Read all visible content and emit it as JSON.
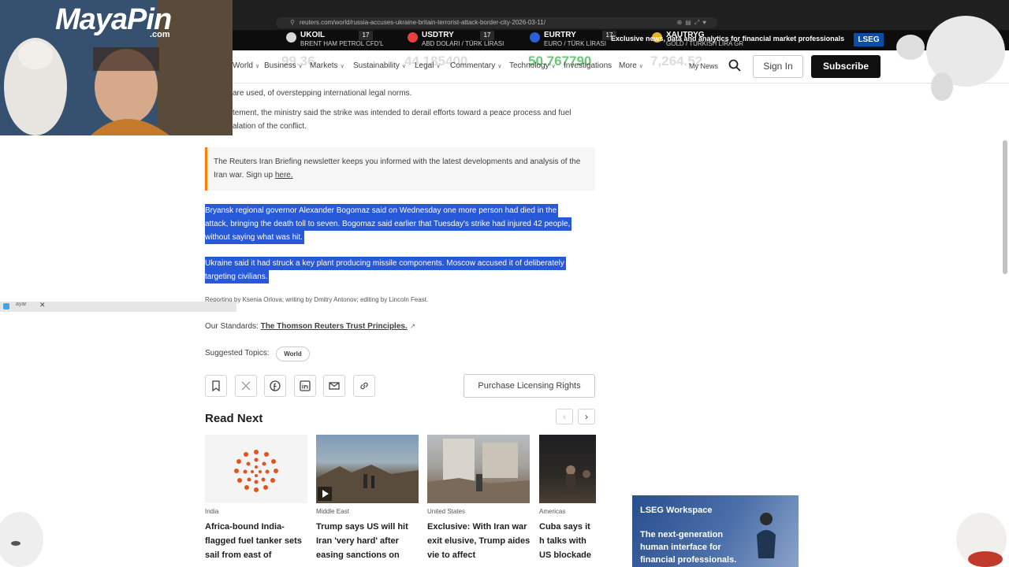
{
  "browser": {
    "url": "reuters.com/world/russia-accuses-ukraine-britain-terrorist-attack-border-city-2026-03-11/"
  },
  "ticker": [
    {
      "symbol": "UKOIL",
      "sub": "BRENT HAM PETROL CFD'L",
      "value": "99.36",
      "icon_color": "#d9d9d9"
    },
    {
      "symbol": "USDTRY",
      "sub": "ABD DOLARI / TÜRK LİRASI",
      "value": "44.185400",
      "icon_color": "#e8413c"
    },
    {
      "symbol": "EURTRY",
      "sub": "EURO / TÜRK LİRASI",
      "value": "50.767790",
      "icon_color": "#2b5fd9"
    },
    {
      "symbol": "XAUTRYG",
      "sub": "GOLD / TURKISH LIRA GR",
      "value": "7,264.52",
      "icon_color": "#e6b422"
    }
  ],
  "lseg_promo": {
    "text": "Exclusive news, data and analytics for financial market professionals",
    "badge": "LSEG"
  },
  "nav": {
    "items": [
      "World",
      "Business",
      "Markets",
      "Sustainability",
      "Legal",
      "Commentary",
      "Technology",
      "Investigations",
      "More"
    ],
    "my_news": "My News",
    "sign_in": "Sign In",
    "subscribe": "Subscribe"
  },
  "article": {
    "p1": "are used, of overstepping international legal norms.",
    "p2_line1": "tement, the ministry said the strike was intended to derail efforts toward a peace process and fuel",
    "p2_line2": "alation of the conflict.",
    "briefing": "The Reuters Iran Briefing newsletter keeps you informed with the latest developments and analysis of the Iran war. Sign up",
    "briefing_link": "here.",
    "highlight_1": [
      "Bryansk regional governor Alexander Bogomaz said on Wednesday one more person had died in the",
      "attack, bringing the death toll to seven. Bogomaz said earlier that Tuesday's strike had injured 42 people,",
      "without saying what was hit."
    ],
    "highlight_2": [
      "Ukraine said it had struck a key plant producing missile components. Moscow accused it of deliberately",
      "targeting civilians."
    ],
    "credits": "Reporting by Ksenia Orlova; writing by Dmitry Antonov; editing by Lincoln Feast.",
    "standards_label": "Our Standards:",
    "standards_link": "The Thomson Reuters Trust Principles.",
    "topics_label": "Suggested Topics:",
    "topic": "World",
    "purchase": "Purchase Licensing Rights"
  },
  "read_next": {
    "heading": "Read Next",
    "cards": [
      {
        "category": "India",
        "title": "Africa-bound India-flagged fuel tanker sets sail from east of"
      },
      {
        "category": "Middle East",
        "title": "Trump says US will hit Iran 'very hard' after easing sanctions on"
      },
      {
        "category": "United States",
        "title": "Exclusive: With Iran war exit elusive, Trump aides vie to affect"
      },
      {
        "category": "Americas",
        "title": "Cuba says it h talks with US blockade"
      }
    ]
  },
  "ad": {
    "title": "LSEG Workspace",
    "copy": "The next-generation human interface for financial professionals."
  },
  "stream": {
    "logo": "MayaPin",
    "logo_suffix": ".com",
    "bar_label": "ayar"
  }
}
